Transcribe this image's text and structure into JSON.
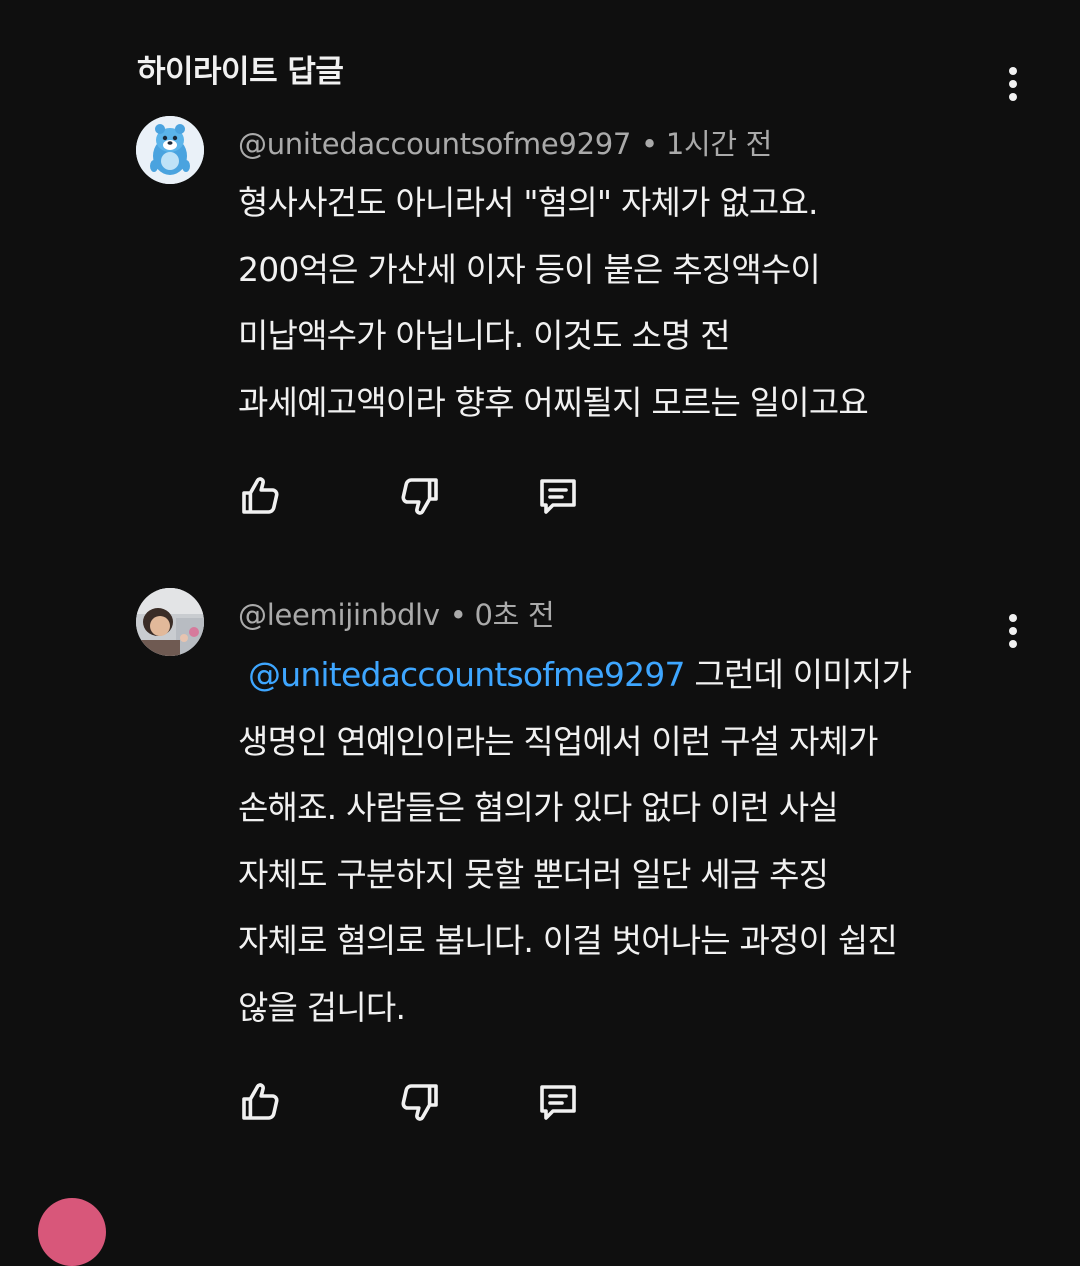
{
  "section": {
    "title": "하이라이트 답글"
  },
  "comments": [
    {
      "author": "@unitedaccountsofme9297",
      "separator": "•",
      "time": "1시간 전",
      "mention": "",
      "lines": [
        "형사사건도 아니라서 \"혐의\" 자체가 없고요.",
        "200억은 가산세 이자 등이 붙은 추징액수이",
        "미납액수가 아닙니다. 이것도 소명 전",
        "과세예고액이라 향후 어찌될지 모르는 일이고요"
      ],
      "avatar_icon": "blue-cartoon-avatar"
    },
    {
      "author": "@leemijinbdlv",
      "separator": "•",
      "time": "0초 전",
      "mention": "@unitedaccountsofme9297",
      "first_line_rest": "그런데 이미지가",
      "lines": [
        "생명인 연예인이라는 직업에서 이런 구설 자체가",
        "손해죠. 사람들은 혐의가 있다 없다 이런 사실",
        "자체도 구분하지 못할 뿐더러 일단 세금 추징",
        "자체로 혐의로 봅니다. 이걸 벗어나는 과정이 쉽진",
        "않을 겁니다."
      ],
      "avatar_icon": "photo-avatar"
    }
  ],
  "icons": {
    "like": "thumbs-up-icon",
    "dislike": "thumbs-down-icon",
    "reply": "reply-comment-icon",
    "menu": "more-vertical-icon"
  },
  "colors": {
    "background": "#0f0f0f",
    "text": "#f1f1f1",
    "meta": "#aaaaaa",
    "mention": "#3ea6ff"
  }
}
